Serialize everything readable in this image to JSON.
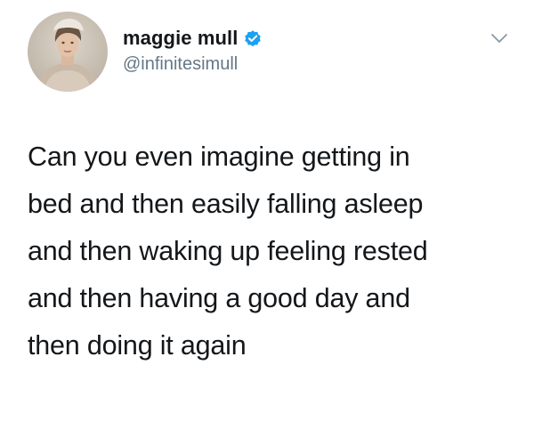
{
  "tweet": {
    "author": {
      "display_name": "maggie mull",
      "handle": "@infinitesimull",
      "verified": true,
      "verified_color": "#1da1f2",
      "avatar_icon": "user-avatar"
    },
    "menu_icon": "chevron-down-icon",
    "text": "Can you even imagine getting in\nbed and then easily falling asleep\nand then waking up feeling rested\nand then having a good day and\nthen doing it again"
  }
}
